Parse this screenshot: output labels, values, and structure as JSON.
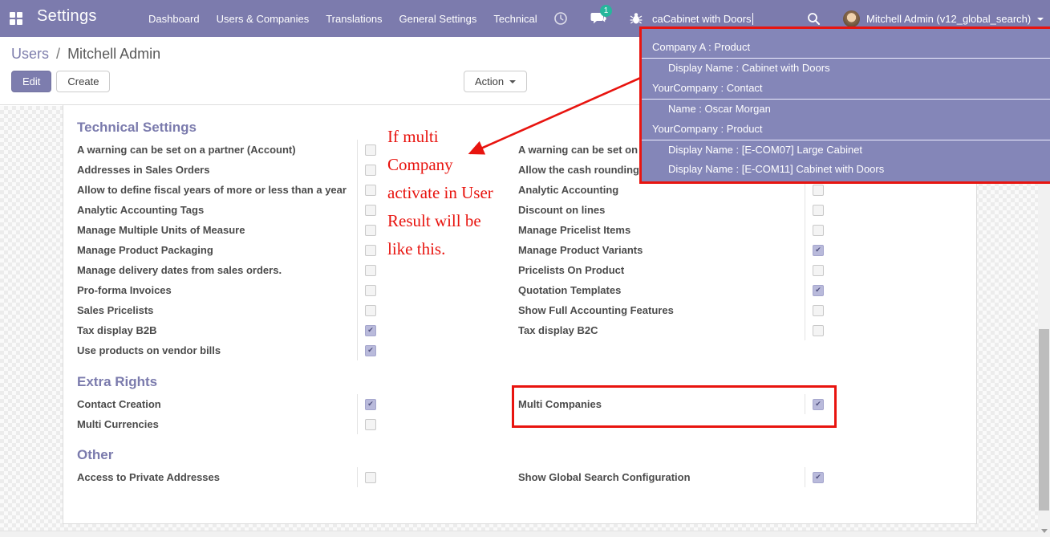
{
  "colors": {
    "navbar_bg": "#7c7bad",
    "dropdown_bg": "#8486b8",
    "annotation_red": "#e8140f",
    "badge_teal": "#26b79c",
    "accent_purple": "#7d7dac",
    "checkbox_checked_bg": "#b9badb"
  },
  "navbar": {
    "brand": "Settings",
    "menu_items": [
      "Dashboard",
      "Users & Companies",
      "Translations",
      "General Settings",
      "Technical"
    ],
    "chat_badge": "1",
    "search_value": "caCabinet with Doors",
    "user_name": "Mitchell Admin (v12_global_search)"
  },
  "breadcrumb": {
    "parent": "Users",
    "separator": "/",
    "current": "Mitchell Admin"
  },
  "actions": {
    "edit": "Edit",
    "create": "Create",
    "action": "Action"
  },
  "search_dropdown": {
    "groups": [
      {
        "header": "Company A : Product",
        "items": [
          "Display Name : Cabinet with Doors"
        ]
      },
      {
        "header": "YourCompany : Contact",
        "items": [
          "Name : Oscar Morgan"
        ]
      },
      {
        "header": "YourCompany : Product",
        "items": [
          "Display Name : [E-COM07] Large Cabinet",
          "Display Name : [E-COM11] Cabinet with Doors"
        ]
      }
    ]
  },
  "annotation": {
    "lines": [
      "If multi",
      "Company",
      "activate in User",
      "Result will be",
      "like this."
    ]
  },
  "sections": [
    {
      "title": "Technical Settings",
      "left": [
        {
          "label": "A warning can be set on a partner (Account)",
          "checked": false
        },
        {
          "label": "Addresses in Sales Orders",
          "checked": false
        },
        {
          "label": "Allow to define fiscal years of more or less than a year",
          "checked": false
        },
        {
          "label": "Analytic Accounting Tags",
          "checked": false
        },
        {
          "label": "Manage Multiple Units of Measure",
          "checked": false
        },
        {
          "label": "Manage Product Packaging",
          "checked": false
        },
        {
          "label": "Manage delivery dates from sales orders.",
          "checked": false
        },
        {
          "label": "Pro-forma Invoices",
          "checked": false
        },
        {
          "label": "Sales Pricelists",
          "checked": false
        },
        {
          "label": "Tax display B2B",
          "checked": true
        },
        {
          "label": "Use products on vendor bills",
          "checked": true
        }
      ],
      "right": [
        {
          "label": "A warning can be set on a",
          "checked": false
        },
        {
          "label": "Allow the cash rounding",
          "checked": false
        },
        {
          "label": "Analytic Accounting",
          "checked": false
        },
        {
          "label": "Discount on lines",
          "checked": false
        },
        {
          "label": "Manage Pricelist Items",
          "checked": false
        },
        {
          "label": "Manage Product Variants",
          "checked": true
        },
        {
          "label": "Pricelists On Product",
          "checked": false
        },
        {
          "label": "Quotation Templates",
          "checked": true
        },
        {
          "label": "Show Full Accounting Features",
          "checked": false
        },
        {
          "label": "Tax display B2C",
          "checked": false
        }
      ]
    },
    {
      "title": "Extra Rights",
      "left": [
        {
          "label": "Contact Creation",
          "checked": true
        },
        {
          "label": "Multi Currencies",
          "checked": false
        }
      ],
      "right": [
        {
          "label": "Multi Companies",
          "checked": true,
          "highlighted": true
        }
      ]
    },
    {
      "title": "Other",
      "left": [
        {
          "label": "Access to Private Addresses",
          "checked": false
        }
      ],
      "right": [
        {
          "label": "Show Global Search Configuration",
          "checked": true
        }
      ]
    }
  ]
}
